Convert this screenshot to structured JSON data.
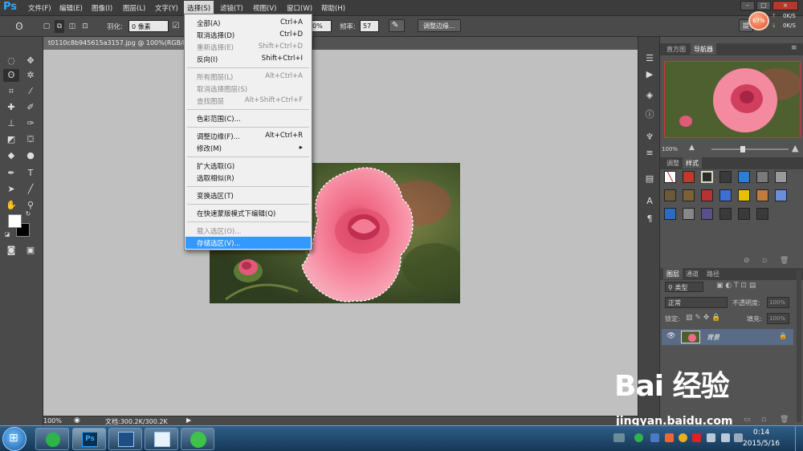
{
  "app": {
    "logo": "Ps"
  },
  "menubar": {
    "items": [
      {
        "label": "文件(F)"
      },
      {
        "label": "编辑(E)"
      },
      {
        "label": "图像(I)"
      },
      {
        "label": "图层(L)"
      },
      {
        "label": "文字(Y)"
      },
      {
        "label": "选择(S)"
      },
      {
        "label": "滤镜(T)"
      },
      {
        "label": "视图(V)"
      },
      {
        "label": "窗口(W)"
      },
      {
        "label": "帮助(H)"
      }
    ],
    "active_index": 5,
    "window_buttons": [
      "–",
      "□",
      "×"
    ]
  },
  "options_bar": {
    "feather_label": "羽化:",
    "feather_value": "0 像素",
    "width_value": "0%",
    "frequency_label": "频率:",
    "frequency_value": "57",
    "refine_edge_button": "调整边缘...",
    "cut_button": "提"
  },
  "performance": {
    "percent": "67%",
    "upload": "0K/S",
    "download": "0K/S"
  },
  "document": {
    "tab_title": "t0110c8b945615a3157.jpg @ 100%(RGB/8#)",
    "zoom": "100%",
    "doc_info": "文档:300.2K/300.2K"
  },
  "select_menu": {
    "items": [
      {
        "label": "全部(A)",
        "shortcut": "Ctrl+A",
        "enabled": true
      },
      {
        "label": "取消选择(D)",
        "shortcut": "Ctrl+D",
        "enabled": true
      },
      {
        "label": "重新选择(E)",
        "shortcut": "Shift+Ctrl+D",
        "enabled": false
      },
      {
        "label": "反向(I)",
        "shortcut": "Shift+Ctrl+I",
        "enabled": true
      },
      {
        "separator": true
      },
      {
        "label": "所有图层(L)",
        "shortcut": "Alt+Ctrl+A",
        "enabled": false
      },
      {
        "label": "取消选择图层(S)",
        "shortcut": "",
        "enabled": false
      },
      {
        "label": "查找图层",
        "shortcut": "Alt+Shift+Ctrl+F",
        "enabled": false
      },
      {
        "separator": true
      },
      {
        "label": "色彩范围(C)...",
        "shortcut": "",
        "enabled": true
      },
      {
        "separator": true
      },
      {
        "label": "调整边缘(F)...",
        "shortcut": "Alt+Ctrl+R",
        "enabled": true
      },
      {
        "label": "修改(M)",
        "shortcut": "▸",
        "enabled": true
      },
      {
        "separator": true
      },
      {
        "label": "扩大选取(G)",
        "shortcut": "",
        "enabled": true
      },
      {
        "label": "选取相似(R)",
        "shortcut": "",
        "enabled": true
      },
      {
        "separator": true
      },
      {
        "label": "变换选区(T)",
        "shortcut": "",
        "enabled": true
      },
      {
        "separator": true
      },
      {
        "label": "在快速蒙版模式下编辑(Q)",
        "shortcut": "",
        "enabled": true
      },
      {
        "separator": true
      },
      {
        "label": "载入选区(O)...",
        "shortcut": "",
        "enabled": false
      },
      {
        "label": "存储选区(V)...",
        "shortcut": "",
        "enabled": true,
        "highlighted": true
      }
    ]
  },
  "navigator": {
    "tabs": [
      "直方图",
      "导航器"
    ],
    "active_tab": "导航器",
    "zoom": "100%"
  },
  "styles_panel": {
    "tabs": [
      "调整",
      "样式"
    ],
    "active_tab": "样式",
    "swatch_colors": [
      "#ffffff",
      "#c0392b",
      "#2c2c2c",
      "#3a3a3a",
      "#2d7fd3",
      "#7a7a7a",
      "#9a9a9a",
      "#6b5a3a",
      "#7a6236",
      "#b83232",
      "#3d6fd1",
      "#e5c200",
      "#c17b3b",
      "#6a8fd8",
      "#2a6bc4",
      "#888888",
      "#5a4f8c",
      "#3a3a3a",
      "#3a3a3a",
      "#3a3a3a"
    ]
  },
  "layers_panel": {
    "tabs": [
      "图层",
      "通道",
      "路径"
    ],
    "active_tab": "图层",
    "filter_label": "类型",
    "blend_mode": "正常",
    "opacity_label": "不透明度:",
    "opacity_value": "100%",
    "lock_label": "锁定:",
    "fill_label": "填充:",
    "fill_value": "100%",
    "layer_name": "背景"
  },
  "taskbar": {
    "time": "0:14",
    "date": "2015/5/16",
    "ps_label": "Ps"
  },
  "watermark": {
    "logo": "Bai 经验",
    "url": "jingyan.baidu.com"
  },
  "colors": {
    "menu_highlight": "#3399ff",
    "canvas_bg": "#c0c0c0",
    "panel_bg": "#535353"
  }
}
